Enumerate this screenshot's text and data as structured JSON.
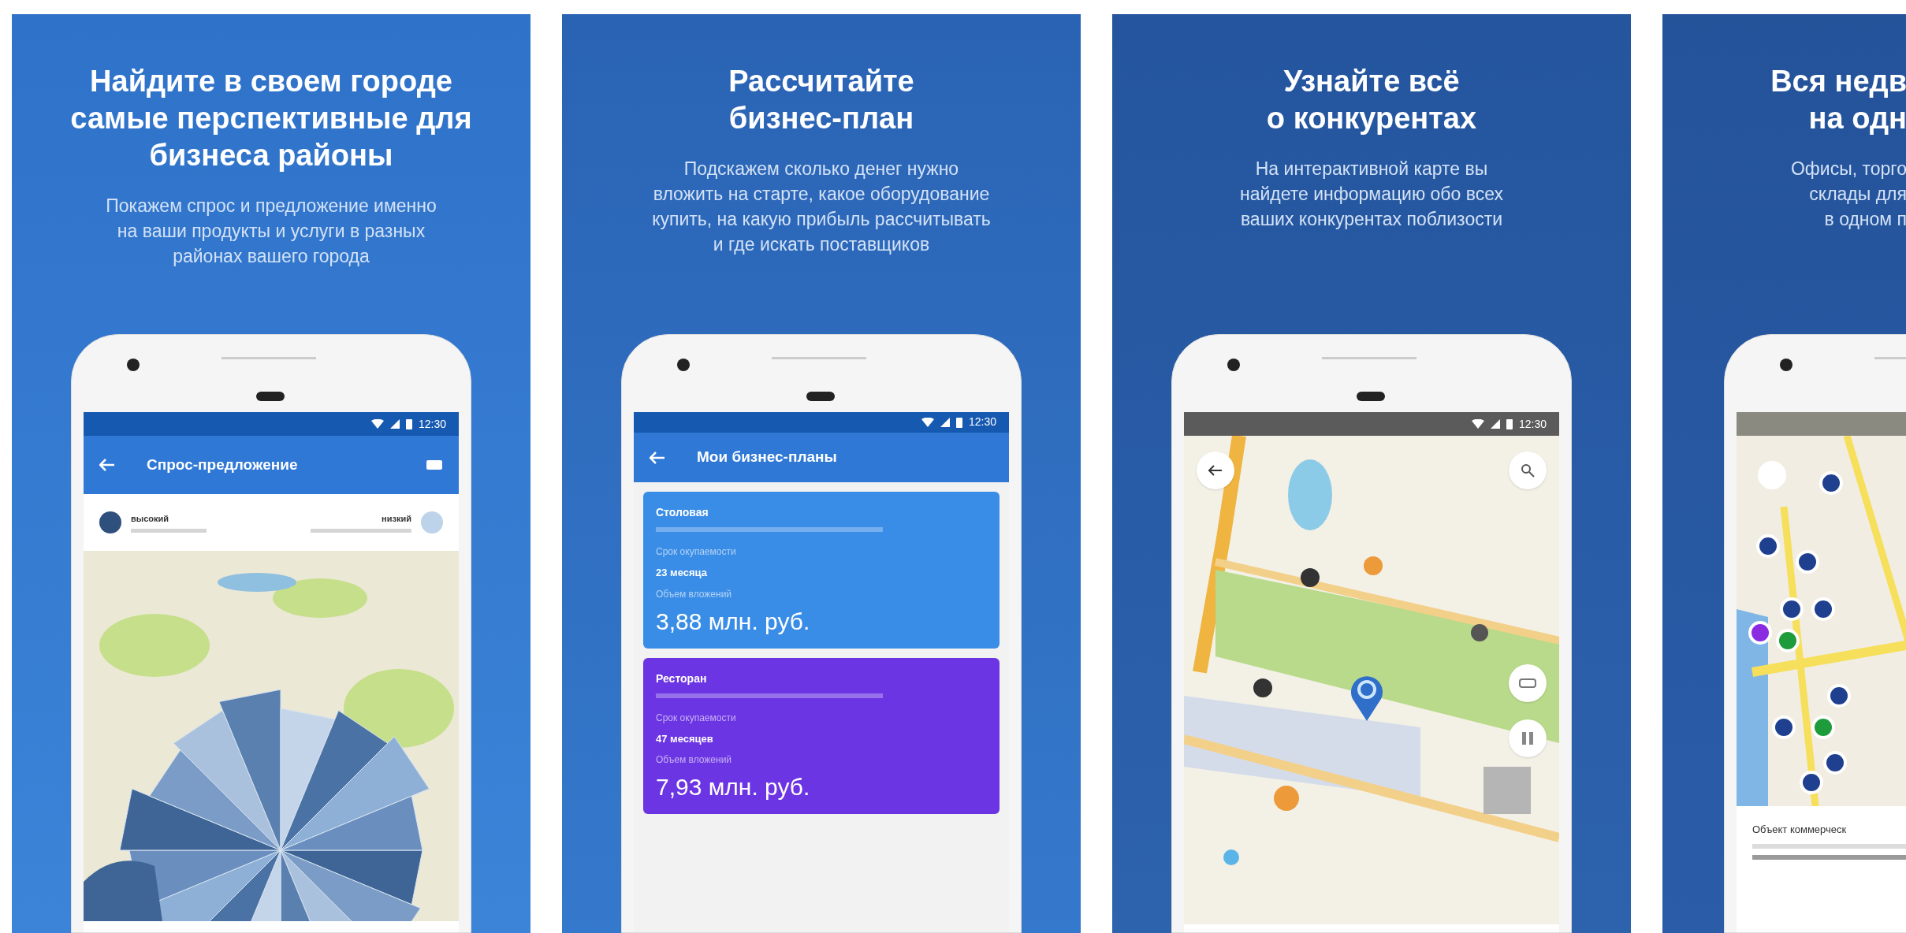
{
  "panels": [
    {
      "kind": "demand",
      "title_lines": [
        "Найдите в своем городе",
        "самые перспективные для",
        "бизнеса районы"
      ],
      "subtitle_lines": [
        "Покажем спрос и предложение именно",
        "на ваши продукты и услуги в разных",
        "районах вашего города"
      ],
      "screen": {
        "time": "12:30",
        "app_title": "Спрос-предложение",
        "legend": [
          "высокий",
          "низкий"
        ]
      }
    },
    {
      "kind": "plans",
      "title_lines": [
        "Рассчитайте",
        "бизнес-план"
      ],
      "subtitle_lines": [
        "Подскажем сколько денег нужно",
        "вложить на старте, какое оборудование",
        "купить, на какую прибыль рассчитывать",
        "и где искать поставщиков"
      ],
      "screen": {
        "time": "12:30",
        "app_title": "Мои бизнес-планы",
        "cards": [
          {
            "name": "Столовая",
            "color": "#3a8de6",
            "payback_label": "Срок окупаемости",
            "payback": "23 месяца",
            "investment_label": "Объем вложений",
            "amount": "3,88 млн. руб."
          },
          {
            "name": "Ресторан",
            "color": "#6c35e3",
            "payback_label": "Срок окупаемости",
            "payback": "47 месяцев",
            "investment_label": "Объем вложений",
            "amount": "7,93 млн. руб."
          }
        ]
      }
    },
    {
      "kind": "competitors",
      "title_lines": [
        "Узнайте всё",
        "о конкурентах"
      ],
      "subtitle_lines": [
        "На интерактивной карте вы",
        "найдете информацию обо всех",
        "ваших конкурентах поблизости"
      ],
      "screen": {
        "time": "12:30"
      }
    },
    {
      "kind": "realty",
      "title_lines": [
        "Вся недв",
        "на одн"
      ],
      "subtitle_lines": [
        "Офисы, торго",
        "склады для",
        "в одном п"
      ],
      "screen": {
        "card_title": "Объект коммерческ"
      }
    }
  ]
}
